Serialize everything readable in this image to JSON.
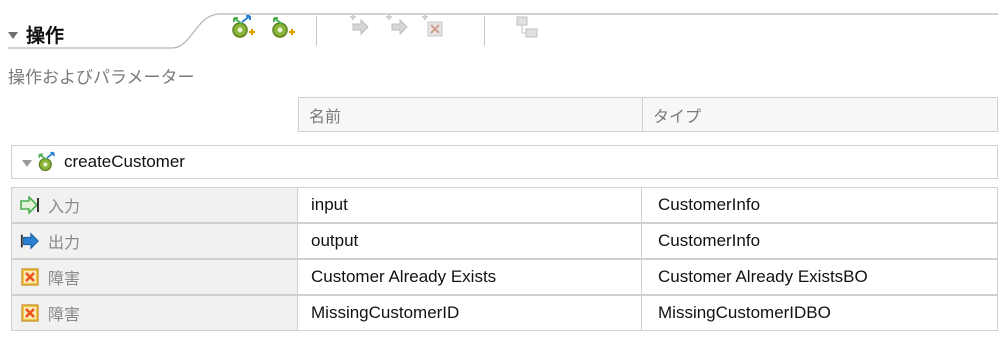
{
  "section": {
    "title": "操作",
    "subtitle": "操作およびパラメーター"
  },
  "toolbar": {
    "buttons": [
      {
        "icon": "add-request-response-operation-icon",
        "enabled": true
      },
      {
        "icon": "add-one-way-operation-icon",
        "enabled": true
      },
      {
        "icon": "add-input-icon",
        "enabled": false
      },
      {
        "icon": "add-output-icon",
        "enabled": false
      },
      {
        "icon": "add-fault-icon",
        "enabled": false
      },
      {
        "icon": "show-business-object-icon",
        "enabled": false
      }
    ]
  },
  "table": {
    "columns": [
      "名前",
      "タイプ"
    ],
    "operation": {
      "name": "createCustomer",
      "icon": "operation-icon"
    },
    "rows": [
      {
        "kind": "入力",
        "icon": "input-icon",
        "name": "input",
        "type": "CustomerInfo"
      },
      {
        "kind": "出力",
        "icon": "output-icon",
        "name": "output",
        "type": "CustomerInfo"
      },
      {
        "kind": "障害",
        "icon": "fault-icon",
        "name": "Customer Already Exists",
        "type": "Customer Already ExistsBO"
      },
      {
        "kind": "障害",
        "icon": "fault-icon",
        "name": "MissingCustomerID",
        "type": "MissingCustomerIDBO"
      }
    ]
  },
  "colors": {
    "fault": "#e8541c",
    "input": "#4caf50",
    "output": "#2a7fd4",
    "gear": "#8ab53a"
  }
}
